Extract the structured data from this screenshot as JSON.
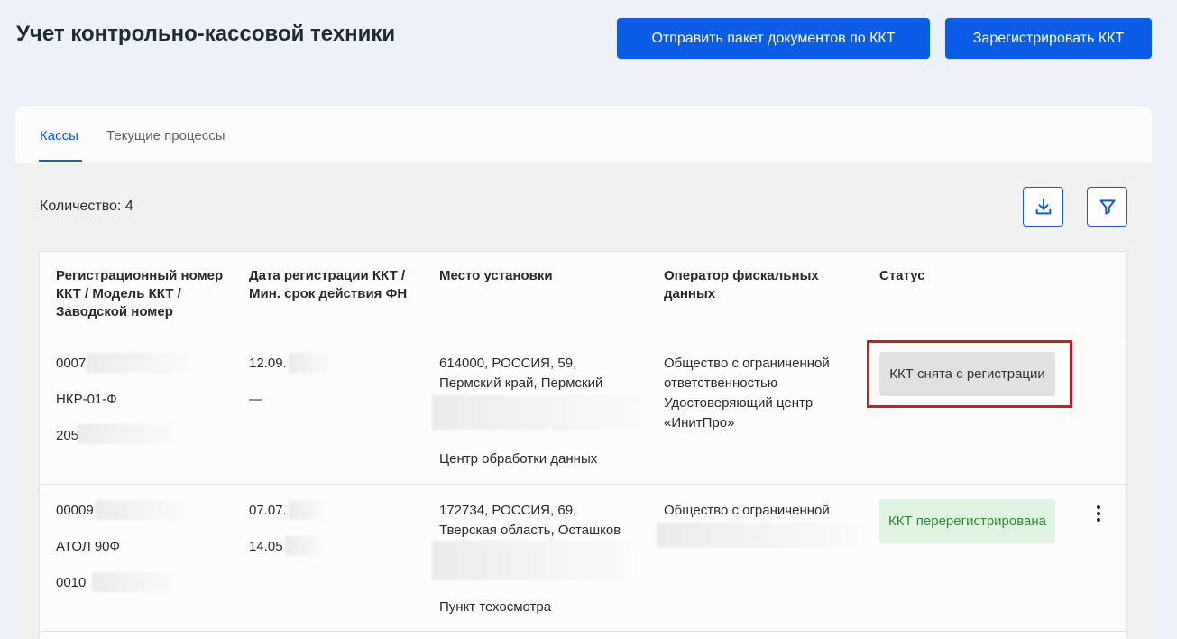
{
  "header": {
    "title": "Учет контрольно-кассовой техники",
    "send_button": "Отправить пакет документов по ККТ",
    "register_button": "Зарегистрировать ККТ"
  },
  "tabs": [
    {
      "label": "Кассы",
      "active": true
    },
    {
      "label": "Текущие процессы",
      "active": false
    }
  ],
  "count_label": "Количество: 4",
  "toolbar": {
    "download_icon": "download-icon",
    "filter_icon": "filter-icon"
  },
  "table": {
    "columns": [
      "Регистрационный номер ККТ / Модель ККТ / Заводской номер",
      "Дата регистрации ККТ / Мин. срок действия ФН",
      "Место установки",
      "Оператор фискальных данных",
      "Статус"
    ],
    "rows": [
      {
        "reg_number": "0007",
        "model": "НКР-01-Ф",
        "serial": "205",
        "reg_date": "12.09.",
        "fn_term": "—",
        "address_line1": "614000, РОССИЯ, 59,",
        "address_line2": "Пермский край, Пермский",
        "place_name": "Центр обработки данных",
        "operator_line1": "Общество с ограниченной",
        "operator_line2": "ответственностью",
        "operator_line3": "Удостоверяющий центр",
        "operator_line4": "«ИнитПро»",
        "status": "ККТ снята с регистрации",
        "status_color": "#e1e1e1"
      },
      {
        "reg_number": "00009",
        "model": "АТОЛ 90Ф",
        "serial": "0010",
        "reg_date": "07.07.",
        "fn_term": "14.05",
        "address_line1": "172734, РОССИЯ, 69,",
        "address_line2": "Тверская область, Осташков",
        "place_name": "Пункт техосмотра",
        "operator_line1": "Общество с ограниченной",
        "status": "ККТ перерегистрирована",
        "status_color": "#dff5e1"
      }
    ]
  },
  "colors": {
    "accent": "#0b5ce6",
    "highlight_frame": "#d4161d",
    "status_ok_text": "#2f8a3a"
  }
}
